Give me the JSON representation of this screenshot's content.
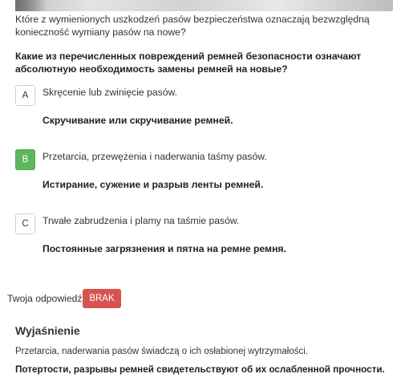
{
  "question": {
    "text_pl": "Które z wymienionych uszkodzeń pasów bezpieczeństwa oznaczają bezwzględną konieczność wymiany pasów na nowe?",
    "text_ru": "Какие из перечисленных повреждений ремней безопасности означают абсолютную необходимость замены ремней на новые?"
  },
  "options": [
    {
      "letter": "A",
      "text_pl": "Skręcenie lub zwinięcie pasów.",
      "text_ru": "Скручивание или скручивание ремней.",
      "correct": false
    },
    {
      "letter": "B",
      "text_pl": "Przetarcia, przewężenia i naderwania taśmy pasów.",
      "text_ru": "Истирание, сужение и разрыв ленты ремней.",
      "correct": true
    },
    {
      "letter": "C",
      "text_pl": "Trwałe zabrudzenia i plamy na taśmie pasów.",
      "text_ru": "Постоянные загрязнения и пятна на ремне ремня.",
      "correct": false
    }
  ],
  "answer": {
    "label": "Twoja odpowiedź:",
    "value": "BRAK"
  },
  "explanation": {
    "title": "Wyjaśnienie",
    "text_pl": "Przetarcia, naderwania pasów świadczą o ich osłabionej wytrzymałości.",
    "text_ru": "Потертости, разрывы ремней свидетельствуют об их ослабленной прочности."
  },
  "colors": {
    "correct": "#5cb85c",
    "badge": "#d9534f"
  }
}
